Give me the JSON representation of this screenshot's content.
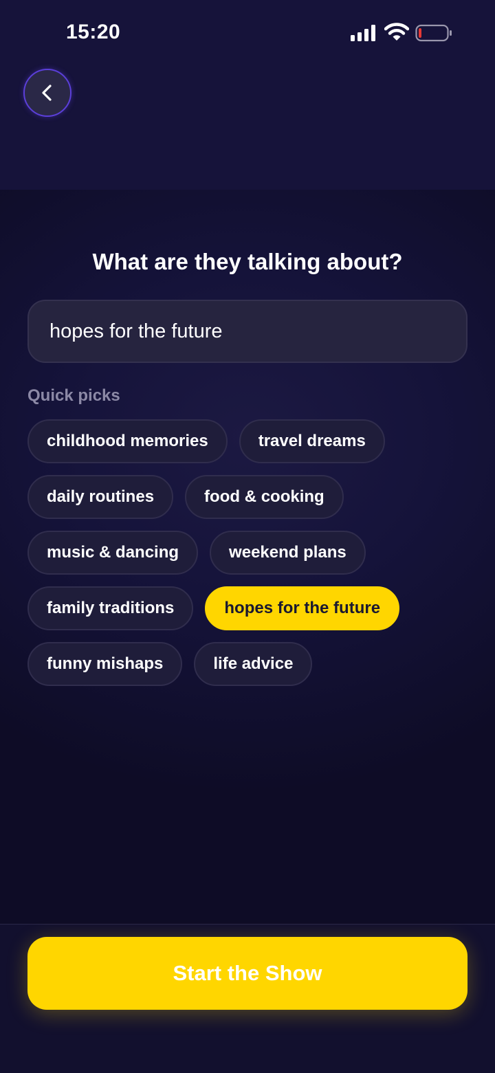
{
  "status_bar": {
    "time": "15:20",
    "icons": [
      "signal-icon",
      "wifi-icon",
      "battery-low-icon"
    ]
  },
  "nav": {
    "back_icon": "chevron-left-icon"
  },
  "main": {
    "heading": "What are they talking about?",
    "topic_value": "hopes for the future",
    "quick_picks_label": "Quick picks",
    "chips": [
      {
        "label": "childhood memories",
        "selected": false
      },
      {
        "label": "travel dreams",
        "selected": false
      },
      {
        "label": "daily routines",
        "selected": false
      },
      {
        "label": "food & cooking",
        "selected": false
      },
      {
        "label": "music & dancing",
        "selected": false
      },
      {
        "label": "weekend plans",
        "selected": false
      },
      {
        "label": "family traditions",
        "selected": false
      },
      {
        "label": "hopes for the future",
        "selected": true
      },
      {
        "label": "funny mishaps",
        "selected": false
      },
      {
        "label": "life advice",
        "selected": false
      }
    ]
  },
  "footer": {
    "start_label": "Start the Show"
  },
  "colors": {
    "accent_yellow": "#FFD600",
    "background": "#141230",
    "chip_bg": "#1F1D3A",
    "back_ring": "#5B3FD9",
    "battery_low": "#E53935"
  }
}
